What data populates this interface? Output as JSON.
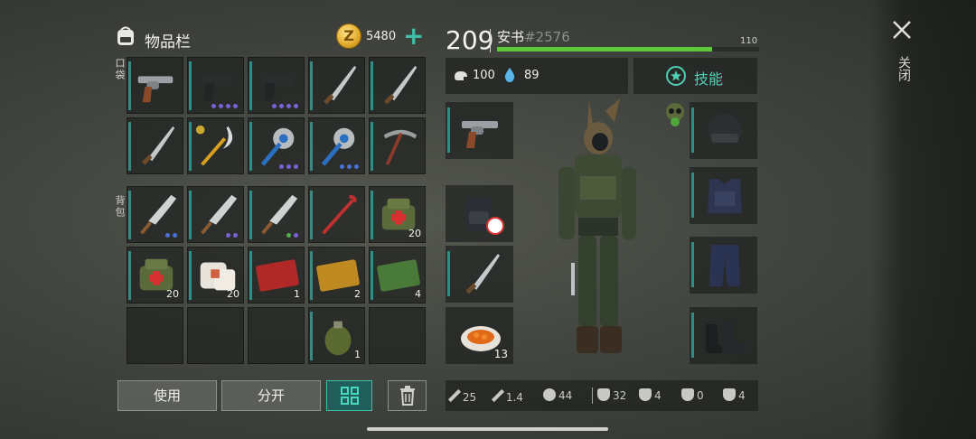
{
  "header": {
    "title": "物品栏",
    "coins": "5480",
    "coin_symbol": "Z",
    "add": "+"
  },
  "sections": {
    "pocket": "口袋",
    "backpack": "背包"
  },
  "pocket_items": [
    {
      "name": "revolver"
    },
    {
      "name": "pistol",
      "dots": [
        "p",
        "p",
        "p",
        "p"
      ]
    },
    {
      "name": "pistol",
      "dots": [
        "p",
        "p",
        "p",
        "p"
      ]
    },
    {
      "name": "machete"
    },
    {
      "name": "machete"
    },
    {
      "name": "machete"
    },
    {
      "name": "golden-scythe"
    },
    {
      "name": "saw-mace",
      "dots": [
        "p",
        "p",
        "p"
      ]
    },
    {
      "name": "saw-mace",
      "dots": [
        "b",
        "b",
        "b"
      ]
    },
    {
      "name": "pickaxe"
    }
  ],
  "backpack_items": [
    {
      "name": "cleaver",
      "dots": [
        "b",
        "b"
      ]
    },
    {
      "name": "cleaver",
      "dots": [
        "p",
        "p"
      ]
    },
    {
      "name": "cleaver",
      "dots": [
        "g",
        "p"
      ]
    },
    {
      "name": "crowbar"
    },
    {
      "name": "medkit",
      "qty": "20"
    },
    {
      "name": "medkit",
      "qty": "20"
    },
    {
      "name": "bandage",
      "qty": "20"
    },
    {
      "name": "combat-coupon",
      "qty": "1"
    },
    {
      "name": "survival-coupon",
      "qty": "2"
    },
    {
      "name": "ration-coupon",
      "qty": "4"
    },
    {
      "name": "empty"
    },
    {
      "name": "empty"
    },
    {
      "name": "empty"
    },
    {
      "name": "grenade",
      "qty": "1"
    },
    {
      "name": "empty"
    }
  ],
  "buttons": {
    "use": "使用",
    "split": "分开",
    "grid": "▦"
  },
  "player": {
    "level": "209",
    "name": "安书",
    "tag": "#2576",
    "xp_max": "110",
    "xp_progress": 0.82
  },
  "stats": {
    "hunger": "100",
    "water": "89"
  },
  "skills": {
    "label": "技能"
  },
  "food_qty": "13",
  "statbar": {
    "s1": "25",
    "s2": "1.4",
    "s3": "44",
    "s4": "32",
    "s5": "4",
    "s6": "0",
    "s7": "4"
  },
  "close": {
    "label": "关闭"
  },
  "colors": {
    "accent": "#3fbfa8",
    "xp": "#5cc83a",
    "bar": "#2f8e86"
  }
}
